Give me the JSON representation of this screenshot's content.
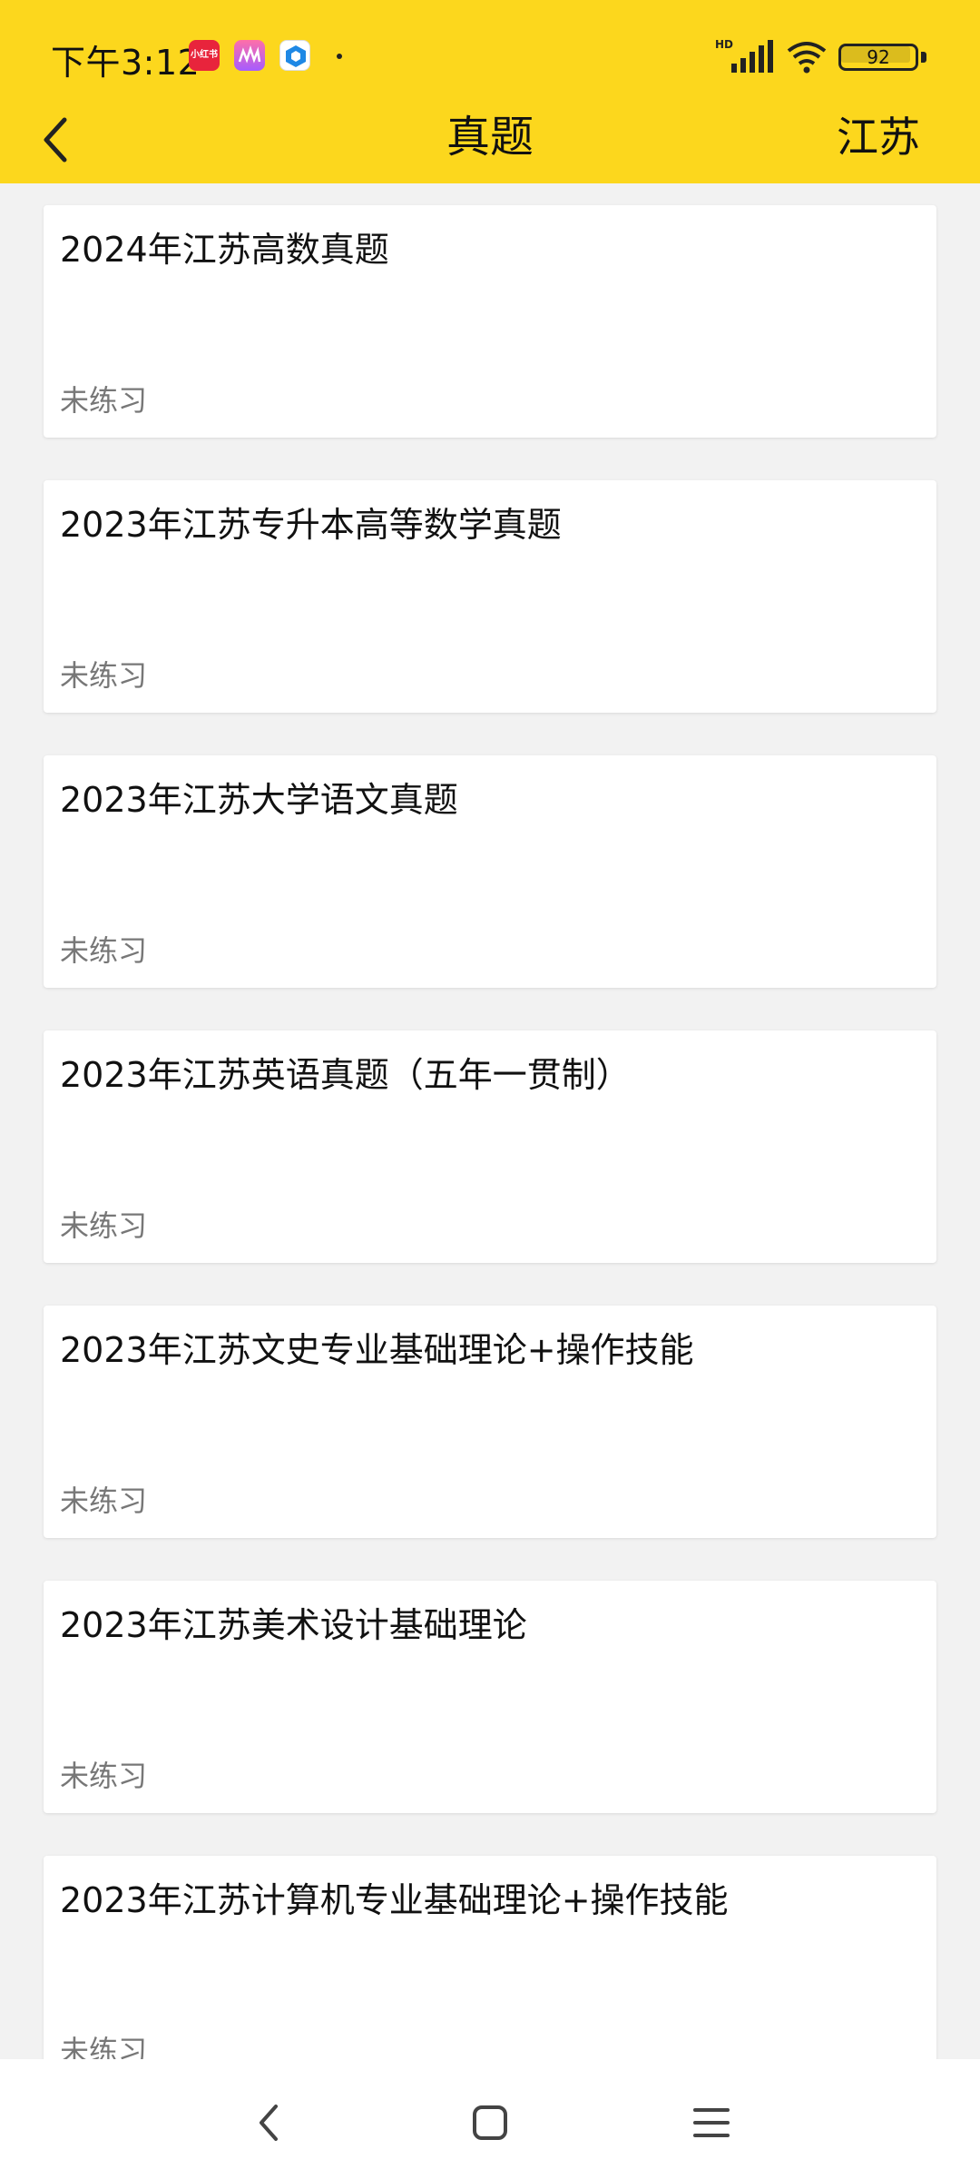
{
  "status_bar": {
    "time": "下午3:12",
    "notif_icons": [
      "app-notification-icon-1",
      "app-notification-icon-2",
      "app-notification-icon-3"
    ],
    "notif_1_label": "小红书",
    "battery_level": "92",
    "signal_label": "HD"
  },
  "header": {
    "title": "真题",
    "region": "江苏",
    "background_color": "#fcd71d"
  },
  "list": {
    "items": [
      {
        "title": "2024年江苏高数真题",
        "status": "未练习"
      },
      {
        "title": "2023年江苏专升本高等数学真题",
        "status": "未练习"
      },
      {
        "title": "2023年江苏大学语文真题",
        "status": "未练习"
      },
      {
        "title": "2023年江苏英语真题（五年一贯制）",
        "status": "未练习"
      },
      {
        "title": "2023年江苏文史专业基础理论+操作技能",
        "status": "未练习"
      },
      {
        "title": "2023年江苏美术设计基础理论",
        "status": "未练习"
      },
      {
        "title": "2023年江苏计算机专业基础理论+操作技能",
        "status": "未练习"
      }
    ]
  },
  "system_nav": {
    "icons": [
      "back-icon",
      "home-icon",
      "menu-icon"
    ]
  }
}
